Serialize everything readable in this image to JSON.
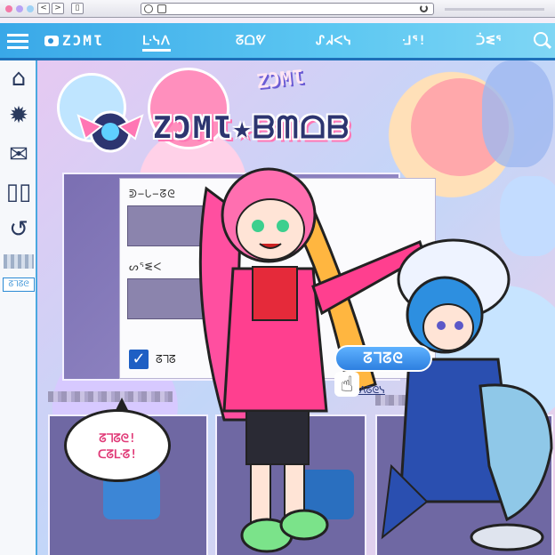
{
  "nav": {
    "brand": "ZƆMƖ",
    "items": [
      {
        "label": "ᒷᓭᐱ"
      },
      {
        "label": "ᘔᗝᕓ"
      },
      {
        "label": "ᔑᖽᐸᓭ"
      },
      {
        "label": "ᒲᕐ!"
      },
      {
        "label": "ᑑᓬᕐ"
      }
    ]
  },
  "sidebar": {
    "tag": "ᘔᒣᘔᘓ"
  },
  "page": {
    "logo_text": "ZƆMƖ★ᗷᗰᗝᗷ",
    "bubble_logo": "ZƆMƖ"
  },
  "form": {
    "username_label": "ᕲ−ᘂ−ᘔᘓ",
    "password_label": "ᔕᕐᓬᐸ",
    "remember_label": "ᘔᒣᘔ",
    "login_button": "ᘔᒣᘔᘓ",
    "register_link": "ᔑᓬᐱᘔᘓᓭ"
  },
  "speech": {
    "line1": "ᘔᒣᘔᘓ!",
    "line2": "ᑕᘔᒷᘔ!"
  },
  "colors": {
    "header": "#39a8e8",
    "accent_pink": "#ff4fa0",
    "button_blue": "#2d7fe0",
    "checkbox_blue": "#1e5fc4"
  }
}
